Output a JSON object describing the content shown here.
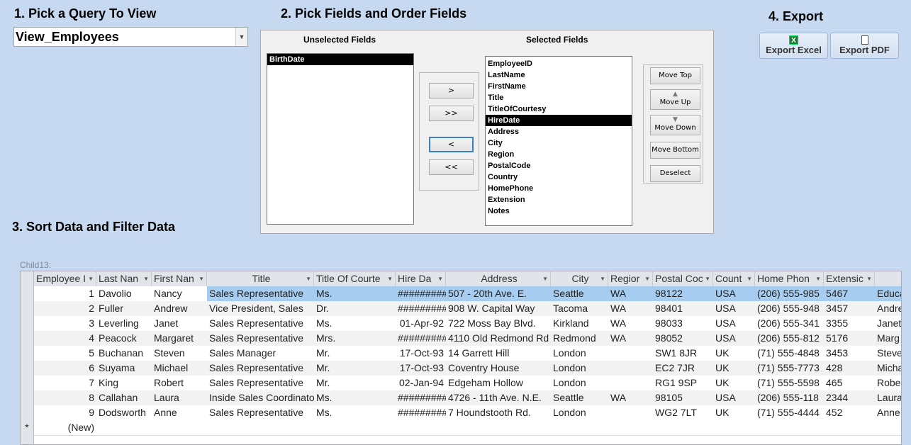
{
  "section1": {
    "title": "1. Pick a Query To View",
    "query_value": "View_Employees"
  },
  "section2": {
    "title": "2. Pick Fields and Order Fields",
    "unselected_label": "Unselected Fields",
    "selected_label": "Selected Fields",
    "unselected": [
      "BirthDate"
    ],
    "selected": [
      "EmployeeID",
      "LastName",
      "FirstName",
      "Title",
      "TitleOfCourtesy",
      "HireDate",
      "Address",
      "City",
      "Region",
      "PostalCode",
      "Country",
      "HomePhone",
      "Extension",
      "Notes"
    ],
    "selected_highlight": "HireDate",
    "buttons": {
      "add": ">",
      "add_all": ">>",
      "remove": "<",
      "remove_all": "<<"
    },
    "order_buttons": {
      "top": "Move Top",
      "up": "Move Up",
      "down": "Move Down",
      "bottom": "Move Bottom",
      "deselect": "Deselect"
    }
  },
  "section3": {
    "title": "3. Sort Data and Filter Data",
    "subform_label": "Child13:"
  },
  "section4": {
    "title": "4. Export",
    "excel": "Export Excel",
    "pdf": "Export PDF"
  },
  "grid": {
    "columns": [
      "Employee I",
      "Last Nan",
      "First Nan",
      "Title",
      "Title Of Courte",
      "Hire Da",
      "Address",
      "City",
      "Regior",
      "Postal Coc",
      "Count",
      "Home Phon",
      "Extensic",
      ""
    ],
    "rows": [
      [
        "1",
        "Davolio",
        "Nancy",
        "Sales Representative",
        "Ms.",
        "#########",
        "507 - 20th Ave. E.",
        "Seattle",
        "WA",
        "98122",
        "USA",
        "(206) 555-985",
        "5467",
        "Educa"
      ],
      [
        "2",
        "Fuller",
        "Andrew",
        "Vice President, Sales",
        "Dr.",
        "#########",
        "908 W. Capital Way",
        "Tacoma",
        "WA",
        "98401",
        "USA",
        "(206) 555-948",
        "3457",
        "Andre"
      ],
      [
        "3",
        "Leverling",
        "Janet",
        "Sales Representative",
        "Ms.",
        "01-Apr-92",
        "722 Moss Bay Blvd.",
        "Kirkland",
        "WA",
        "98033",
        "USA",
        "(206) 555-341",
        "3355",
        "Janet"
      ],
      [
        "4",
        "Peacock",
        "Margaret",
        "Sales Representative",
        "Mrs.",
        "#########",
        "4110 Old Redmond Rd",
        "Redmond",
        "WA",
        "98052",
        "USA",
        "(206) 555-812",
        "5176",
        "Marg"
      ],
      [
        "5",
        "Buchanan",
        "Steven",
        "Sales Manager",
        "Mr.",
        "17-Oct-93",
        "14 Garrett Hill",
        "London",
        "",
        "SW1 8JR",
        "UK",
        "(71) 555-4848",
        "3453",
        "Steve"
      ],
      [
        "6",
        "Suyama",
        "Michael",
        "Sales Representative",
        "Mr.",
        "17-Oct-93",
        "Coventry House",
        "London",
        "",
        "EC2 7JR",
        "UK",
        "(71) 555-7773",
        "428",
        "Micha"
      ],
      [
        "7",
        "King",
        "Robert",
        "Sales Representative",
        "Mr.",
        "02-Jan-94",
        "Edgeham Hollow",
        "London",
        "",
        "RG1 9SP",
        "UK",
        "(71) 555-5598",
        "465",
        "Robe"
      ],
      [
        "8",
        "Callahan",
        "Laura",
        "Inside Sales Coordinator",
        "Ms.",
        "#########",
        "4726 - 11th Ave. N.E.",
        "Seattle",
        "WA",
        "98105",
        "USA",
        "(206) 555-118",
        "2344",
        "Laura"
      ],
      [
        "9",
        "Dodsworth",
        "Anne",
        "Sales Representative",
        "Ms.",
        "#########",
        "7 Houndstooth Rd.",
        "London",
        "",
        "WG2 7LT",
        "UK",
        "(71) 555-4444",
        "452",
        "Anne"
      ]
    ],
    "new_row_marker": "*",
    "new_row_label": "(New)"
  }
}
